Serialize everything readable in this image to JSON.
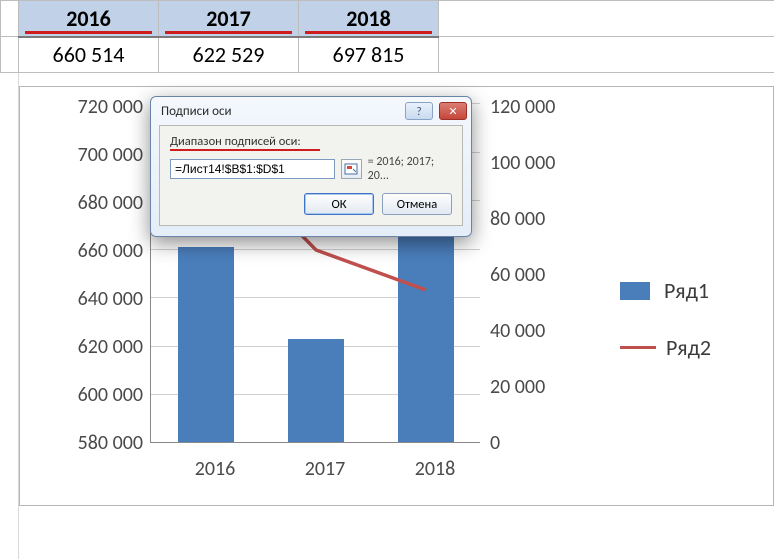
{
  "table": {
    "headers": [
      "2016",
      "2017",
      "2018"
    ],
    "row1": [
      "660 514",
      "622 529",
      "697 815"
    ]
  },
  "chart": {
    "y_left_ticks": [
      "720 000",
      "700 000",
      "680 000",
      "660 000",
      "640 000",
      "620 000",
      "600 000",
      "580 000"
    ],
    "y_right_ticks": [
      "120 000",
      "100 000",
      "80 000",
      "60 000",
      "40 000",
      "20 000",
      "0"
    ],
    "x_ticks": [
      "2016",
      "2017",
      "2018"
    ],
    "legend": {
      "s1": "Ряд1",
      "s2": "Ряд2"
    }
  },
  "dialog": {
    "title": "Подписи оси",
    "field_label": "Диапазон подписей оси:",
    "input_value": "=Лист14!$B$1:$D$1",
    "preview": "= 2016; 2017; 20...",
    "ok": "ОК",
    "cancel": "Отмена"
  },
  "chart_data": {
    "type": "bar",
    "categories": [
      "2016",
      "2017",
      "2018"
    ],
    "series": [
      {
        "name": "Ряд1",
        "type": "bar",
        "axis": "left",
        "values": [
          660514,
          622529,
          697815
        ]
      },
      {
        "name": "Ряд2",
        "type": "line",
        "axis": "right",
        "values": [
          108000,
          68000,
          54000
        ]
      }
    ],
    "y_left": {
      "min": 580000,
      "max": 720000,
      "step": 20000
    },
    "y_right": {
      "min": 0,
      "max": 120000,
      "step": 20000
    },
    "xlabel": "",
    "ylabel": "",
    "title": ""
  }
}
